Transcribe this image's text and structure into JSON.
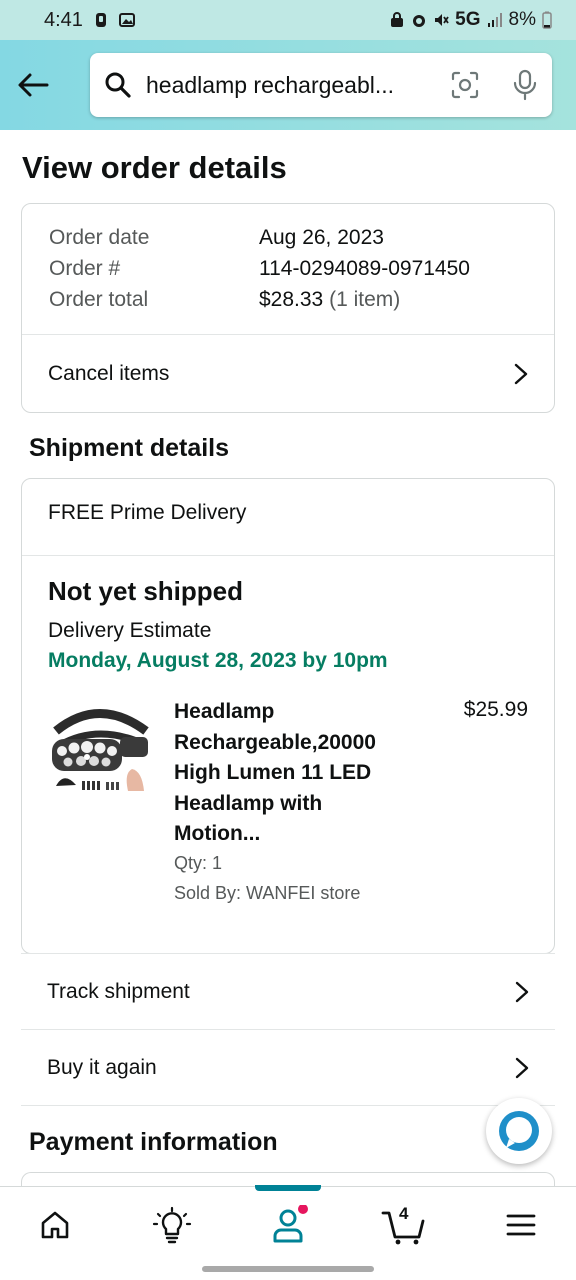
{
  "status_bar": {
    "time": "4:41",
    "network": "5G",
    "battery": "8%"
  },
  "search": {
    "query": "headlamp rechargeabl..."
  },
  "page": {
    "title": "View order details"
  },
  "order": {
    "date_label": "Order date",
    "date_value": "Aug 26, 2023",
    "number_label": "Order #",
    "number_value": "114-0294089-0971450",
    "total_label": "Order total",
    "total_value": "$28.33",
    "total_items": "(1 item)",
    "cancel_label": "Cancel items"
  },
  "shipment": {
    "section_title": "Shipment details",
    "delivery_type": "FREE Prime Delivery",
    "status": "Not yet shipped",
    "estimate_label": "Delivery Estimate",
    "estimate_date": "Monday, August 28, 2023 by 10pm",
    "product": {
      "title": "Headlamp Rechargeable,20000 High Lumen 11 LED Headlamp with Motion...",
      "price": "$25.99",
      "qty": "Qty: 1",
      "seller": "Sold By: WANFEI store"
    }
  },
  "actions": {
    "track": "Track shipment",
    "buy_again": "Buy it again"
  },
  "payment": {
    "section_title": "Payment information"
  },
  "bottom_nav": {
    "items": [
      "home-icon",
      "lightbulb-icon",
      "account-icon",
      "cart-icon",
      "menu-icon"
    ],
    "cart_count": "4",
    "active": "account-icon"
  },
  "colors": {
    "accent": "#008296",
    "delivery_green": "#067d62",
    "header_gradient_start": "#84d8e3",
    "header_gradient_end": "#a5e3dd",
    "notification_dot": "#e6165e"
  }
}
